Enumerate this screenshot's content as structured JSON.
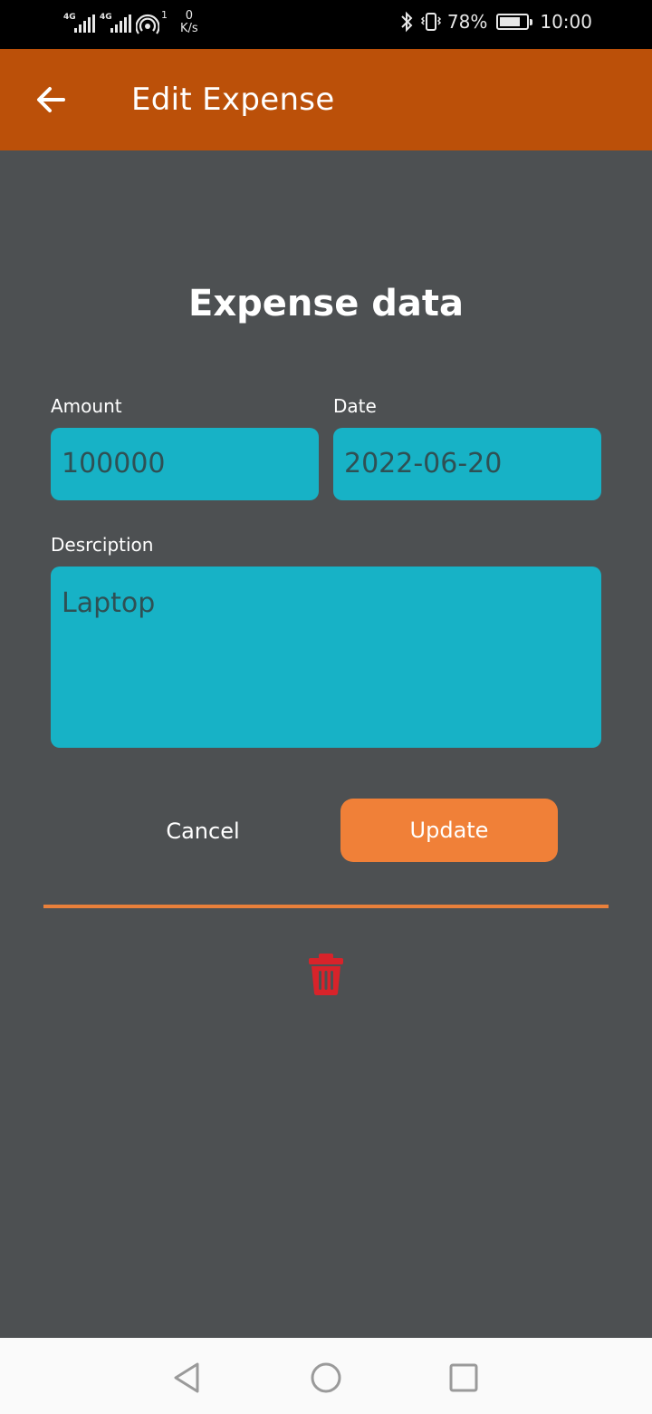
{
  "status_bar": {
    "network_1": "4G",
    "network_2": "4G",
    "sim_badge": "1",
    "speed_value": "0",
    "speed_unit": "K/s",
    "battery_percent": "78%",
    "battery_level": 0.78,
    "time": "10:00"
  },
  "app_bar": {
    "title": "Edit Expense",
    "color": "#bb5009"
  },
  "form": {
    "section_title": "Expense data",
    "amount": {
      "label": "Amount",
      "value": "100000"
    },
    "date": {
      "label": "Date",
      "value": "2022-06-20"
    },
    "description": {
      "label": "Desrciption",
      "value": "Laptop"
    },
    "cancel_label": "Cancel",
    "update_label": "Update"
  },
  "colors": {
    "background": "#4d5052",
    "field": "#17b2c6",
    "accent": "#f08038",
    "delete": "#d8232a"
  },
  "icons": {
    "back": "arrow-left-icon",
    "delete": "trash-icon",
    "nav_back": "triangle-back-icon",
    "nav_home": "circle-home-icon",
    "nav_recents": "square-recents-icon"
  }
}
